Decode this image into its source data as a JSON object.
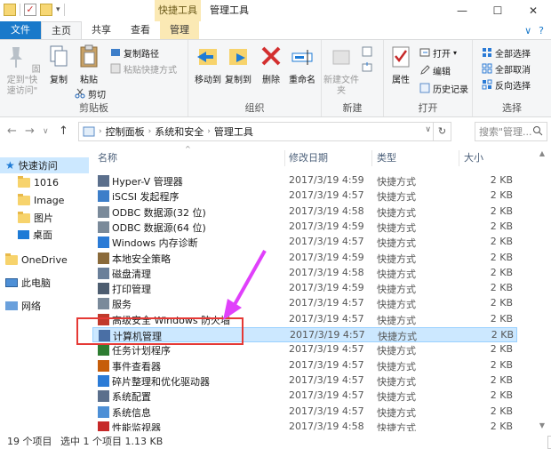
{
  "window": {
    "title": "管理工具",
    "context_tab_header": "快捷工具",
    "controls": {
      "minimize": "—",
      "maximize": "☐",
      "close": "✕"
    }
  },
  "ribbon_tabs": [
    {
      "label": "文件"
    },
    {
      "label": "主页"
    },
    {
      "label": "共享"
    },
    {
      "label": "查看"
    },
    {
      "label": "管理"
    }
  ],
  "ribbon": {
    "clipboard": {
      "label": "剪贴板",
      "pin": "固定到\"快速访问\"",
      "copy": "复制",
      "paste": "粘贴",
      "copy_path": "复制路径",
      "paste_shortcut": "粘贴快捷方式",
      "cut": "剪切"
    },
    "organize": {
      "label": "组织",
      "move_to": "移动到",
      "copy_to": "复制到",
      "delete": "删除",
      "rename": "重命名"
    },
    "new": {
      "label": "新建",
      "new_folder": "新建文件夹"
    },
    "open": {
      "label": "打开",
      "properties": "属性",
      "open": "打开",
      "edit": "编辑",
      "history": "历史记录"
    },
    "select": {
      "label": "选择",
      "select_all": "全部选择",
      "select_none": "全部取消",
      "invert": "反向选择"
    }
  },
  "address": {
    "crumbs": [
      "控制面板",
      "系统和安全",
      "管理工具"
    ],
    "search_placeholder": "搜索\"管理..."
  },
  "nav_pane": {
    "quick_access": "快速访问",
    "items": [
      "1016",
      "Image",
      "图片",
      "桌面"
    ],
    "onedrive": "OneDrive",
    "this_pc": "此电脑",
    "network": "网络"
  },
  "columns": {
    "name": "名称",
    "date": "修改日期",
    "type": "类型",
    "size": "大小"
  },
  "files": [
    {
      "name": "Hyper-V 管理器",
      "date": "2017/3/19 4:59",
      "type": "快捷方式",
      "size": "2 KB"
    },
    {
      "name": "iSCSI 发起程序",
      "date": "2017/3/19 4:57",
      "type": "快捷方式",
      "size": "2 KB"
    },
    {
      "name": "ODBC 数据源(32 位)",
      "date": "2017/3/19 4:58",
      "type": "快捷方式",
      "size": "2 KB"
    },
    {
      "name": "ODBC 数据源(64 位)",
      "date": "2017/3/19 4:59",
      "type": "快捷方式",
      "size": "2 KB"
    },
    {
      "name": "Windows 内存诊断",
      "date": "2017/3/19 4:57",
      "type": "快捷方式",
      "size": "2 KB"
    },
    {
      "name": "本地安全策略",
      "date": "2017/3/19 4:59",
      "type": "快捷方式",
      "size": "2 KB"
    },
    {
      "name": "磁盘清理",
      "date": "2017/3/19 4:58",
      "type": "快捷方式",
      "size": "2 KB"
    },
    {
      "name": "打印管理",
      "date": "2017/3/19 4:59",
      "type": "快捷方式",
      "size": "2 KB"
    },
    {
      "name": "服务",
      "date": "2017/3/19 4:57",
      "type": "快捷方式",
      "size": "2 KB"
    },
    {
      "name": "高级安全 Windows 防火墙",
      "date": "2017/3/19 4:57",
      "type": "快捷方式",
      "size": "2 KB"
    },
    {
      "name": "计算机管理",
      "date": "2017/3/19 4:57",
      "type": "快捷方式",
      "size": "2 KB"
    },
    {
      "name": "任务计划程序",
      "date": "2017/3/19 4:57",
      "type": "快捷方式",
      "size": "2 KB"
    },
    {
      "name": "事件查看器",
      "date": "2017/3/19 4:57",
      "type": "快捷方式",
      "size": "2 KB"
    },
    {
      "name": "碎片整理和优化驱动器",
      "date": "2017/3/19 4:57",
      "type": "快捷方式",
      "size": "2 KB"
    },
    {
      "name": "系统配置",
      "date": "2017/3/19 4:57",
      "type": "快捷方式",
      "size": "2 KB"
    },
    {
      "name": "系统信息",
      "date": "2017/3/19 4:57",
      "type": "快捷方式",
      "size": "2 KB"
    },
    {
      "name": "性能监视器",
      "date": "2017/3/19 4:58",
      "type": "快捷方式",
      "size": "2 KB"
    }
  ],
  "selected_index": 10,
  "status": {
    "count": "19 个项目",
    "selection": "选中 1 个项目  1.13 KB"
  },
  "colors": {
    "accent": "#1979ca",
    "selection": "#cce8ff",
    "annotation_box": "#e53935",
    "annotation_arrow": "#e040fb"
  }
}
